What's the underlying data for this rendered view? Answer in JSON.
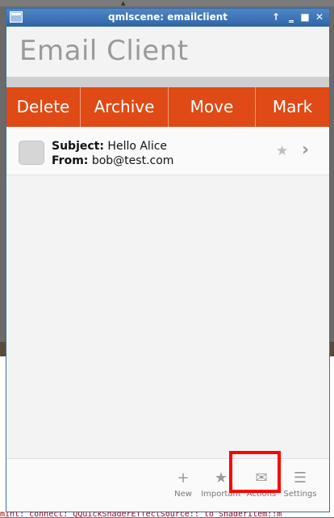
{
  "window": {
    "title": "qmlscene: emailclient"
  },
  "app": {
    "title": "Email Client"
  },
  "actions": [
    "Delete",
    "Archive",
    "Move",
    "Mark"
  ],
  "emails": [
    {
      "subject_label": "Subject:",
      "subject": "Hello Alice",
      "from_label": "From:",
      "from": "bob@test.com"
    }
  ],
  "bottom_tabs": [
    {
      "label": "New",
      "icon": "plus-icon"
    },
    {
      "label": "Important",
      "icon": "star-icon"
    },
    {
      "label": "Actions",
      "icon": "envelope-icon"
    },
    {
      "label": "Settings",
      "icon": "sliders-icon"
    }
  ],
  "colors": {
    "accent": "#df4a16",
    "titlebar": "#3a72b5",
    "highlight": "#ff0000"
  },
  "console": {
    "bottom_text": "mint: connect: QQuickShaderEffectSource:: to ShaderItem::m"
  }
}
